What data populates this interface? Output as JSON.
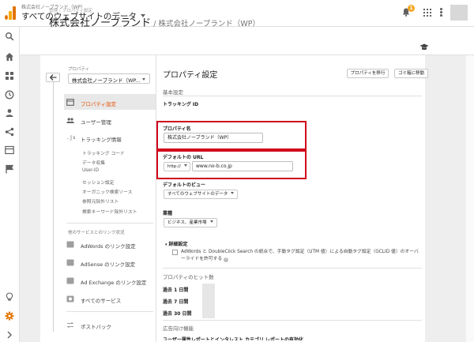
{
  "topbar": {
    "crumb": "株式会社ノーブランド（WP）",
    "account_view": "すべてのウェブサイトのデータ",
    "notification_count": "1",
    "colors": {
      "logo_dark": "#e37400",
      "logo_light": "#f9ab00",
      "badge": "#f5a623"
    }
  },
  "rail": {
    "icons": [
      "search-icon",
      "home-icon",
      "customization-icon",
      "clock-icon",
      "person-icon",
      "acquisition-icon",
      "behavior-icon",
      "flag-icon",
      "lightbulb-icon",
      "gear-icon",
      "expand-icon"
    ]
  },
  "header": {
    "breadcrumb": "管理 › プロパティ設定",
    "title": "株式会社ノーブランド",
    "title_sub": "/ 株式会社ノーブランド（WP）"
  },
  "left_nav": {
    "property_label": "プロパティ",
    "property_value": "株式会社ノーブランド（WP...",
    "items": [
      {
        "label": "プロパティ設定",
        "icon": "property-settings-icon",
        "active": true
      },
      {
        "label": "ユーザー管理",
        "icon": "users-icon"
      },
      {
        "label": "トラッキング情報",
        "icon": "tracking-js-icon"
      }
    ],
    "tracking_sub": [
      "トラッキング コード",
      "データ収集",
      "User-ID",
      "セッション設定",
      "オーガニック検索ソース",
      "参照元除外リスト",
      "検索キーワード除外リスト"
    ],
    "product_link_heading": "他のサービスとのリンク状況",
    "product_links": [
      {
        "label": "AdWords のリンク設定",
        "icon": "adwords-icon"
      },
      {
        "label": "AdSense のリンク設定",
        "icon": "adsense-icon"
      },
      {
        "label": "Ad Exchange のリンク設定",
        "icon": "adexchange-icon"
      },
      {
        "label": "すべてのサービス",
        "icon": "all-products-icon"
      }
    ],
    "postback_label": "ポストバック",
    "active_color": "#e65100"
  },
  "main": {
    "title": "プロパティ設定",
    "move_button": "プロパティを移行",
    "trash_button": "ゴミ箱に移動",
    "basic_settings": "基本設定",
    "tracking_id_label": "トラッキング ID",
    "property_name_label": "プロパティ名",
    "property_name_value": "株式会社ノーブランド（WP）",
    "default_url_label": "デフォルトの URL",
    "protocol": "http://",
    "default_url_value": "www.no-b.co.jp",
    "default_view_label": "デフォルトのビュー",
    "default_view_value": "すべてのウェブサイトのデータ",
    "industry_label": "業種",
    "industry_value": "ビジネス、産業市場",
    "advanced_label": "詳細設定",
    "advanced_checkbox_text": "AdWords と DoubleClick Search の統合で、手動タグ設定（UTM 値）による自動タグ設定（GCLID 値）のオーバーライドを許可する",
    "hits_heading": "プロパティのヒット数",
    "hits_rows": [
      "過去 1 日間",
      "過去 7 日間",
      "過去 30 日間"
    ],
    "ads_heading": "広告向け機能",
    "ads_cut_text": "ユーザー属性レポートとインタレスト カテゴリ レポートの有効化",
    "highlight_color": "#d0021b"
  }
}
